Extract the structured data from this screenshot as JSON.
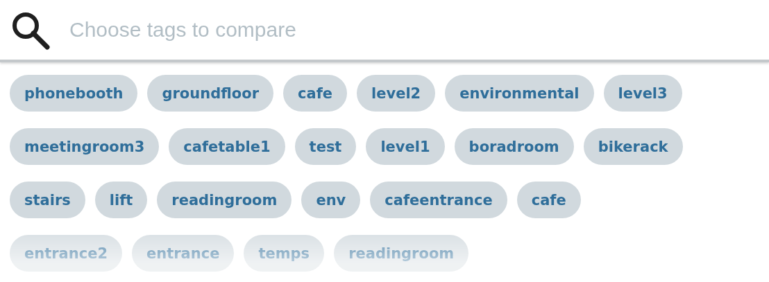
{
  "search": {
    "placeholder": "Choose tags to compare"
  },
  "tag_rows": [
    [
      "phonebooth",
      "groundfloor",
      "cafe",
      "level2",
      "environmental",
      "level3"
    ],
    [
      "meetingroom3",
      "cafetable1",
      "test",
      "level1",
      "boradroom",
      "bikerack"
    ],
    [
      "stairs",
      "lift",
      "readingroom",
      "env",
      "cafeentrance",
      "cafe"
    ],
    [
      "entrance2",
      "entrance",
      "temps",
      "readingroom"
    ]
  ]
}
